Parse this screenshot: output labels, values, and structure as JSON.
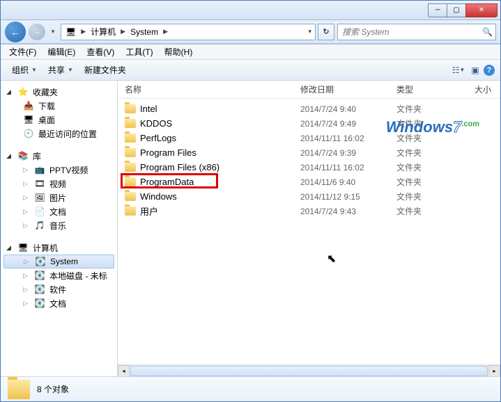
{
  "breadcrumb": {
    "root": "计算机",
    "drive": "System"
  },
  "search": {
    "placeholder": "搜索 System"
  },
  "menu": {
    "file": "文件(F)",
    "edit": "编辑(E)",
    "view": "查看(V)",
    "tools": "工具(T)",
    "help": "帮助(H)"
  },
  "toolbar": {
    "organize": "组织",
    "share": "共享",
    "new_folder": "新建文件夹"
  },
  "columns": {
    "name": "名称",
    "date": "修改日期",
    "type": "类型",
    "size": "大小"
  },
  "nav": {
    "favorites": {
      "label": "收藏夹",
      "items": [
        "下载",
        "桌面",
        "最近访问的位置"
      ]
    },
    "libraries": {
      "label": "库",
      "items": [
        "PPTV视频",
        "视频",
        "图片",
        "文档",
        "音乐"
      ]
    },
    "computer": {
      "label": "计算机",
      "items": [
        "System",
        "本地磁盘 - 未标",
        "软件",
        "文档"
      ]
    }
  },
  "files": [
    {
      "name": "Intel",
      "date": "2014/7/24 9:40",
      "type": "文件夹"
    },
    {
      "name": "KDDOS",
      "date": "2014/7/24 9:49",
      "type": "文件夹"
    },
    {
      "name": "PerfLogs",
      "date": "2014/11/11 16:02",
      "type": "文件夹"
    },
    {
      "name": "Program Files",
      "date": "2014/7/24 9:39",
      "type": "文件夹"
    },
    {
      "name": "Program Files (x86)",
      "date": "2014/11/11 16:02",
      "type": "文件夹"
    },
    {
      "name": "ProgramData",
      "date": "2014/11/6 9:40",
      "type": "文件夹"
    },
    {
      "name": "Windows",
      "date": "2014/11/12 9:15",
      "type": "文件夹"
    },
    {
      "name": "用户",
      "date": "2014/7/24 9:43",
      "type": "文件夹"
    }
  ],
  "status": {
    "count_label": "8 个对象"
  },
  "watermark": "Windows7en",
  "highlighted_index": 5
}
